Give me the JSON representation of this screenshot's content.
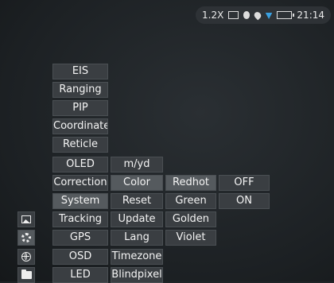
{
  "status_bar": {
    "zoom": "1.2X",
    "clock": "21:14",
    "icons": [
      "aspect-icon",
      "record-icon",
      "location-icon",
      "wifi-icon",
      "battery-icon"
    ]
  },
  "rail": [
    "image-icon",
    "gear-icon",
    "globe-icon",
    "folder-icon"
  ],
  "menu": {
    "main": [
      "EIS",
      "Ranging",
      "PIP",
      "Coordinate",
      "Reticle",
      "OLED",
      "Correction",
      "System",
      "Tracking",
      "GPS",
      "OSD",
      "LED"
    ],
    "system_sub": [
      "m/yd",
      "Color",
      "Reset",
      "Update",
      "Lang",
      "Timezone",
      "Blindpixel"
    ],
    "color_sub": [
      "Redhot",
      "Green",
      "Golden",
      "Violet"
    ],
    "redhot_sub": [
      "OFF",
      "ON"
    ]
  }
}
